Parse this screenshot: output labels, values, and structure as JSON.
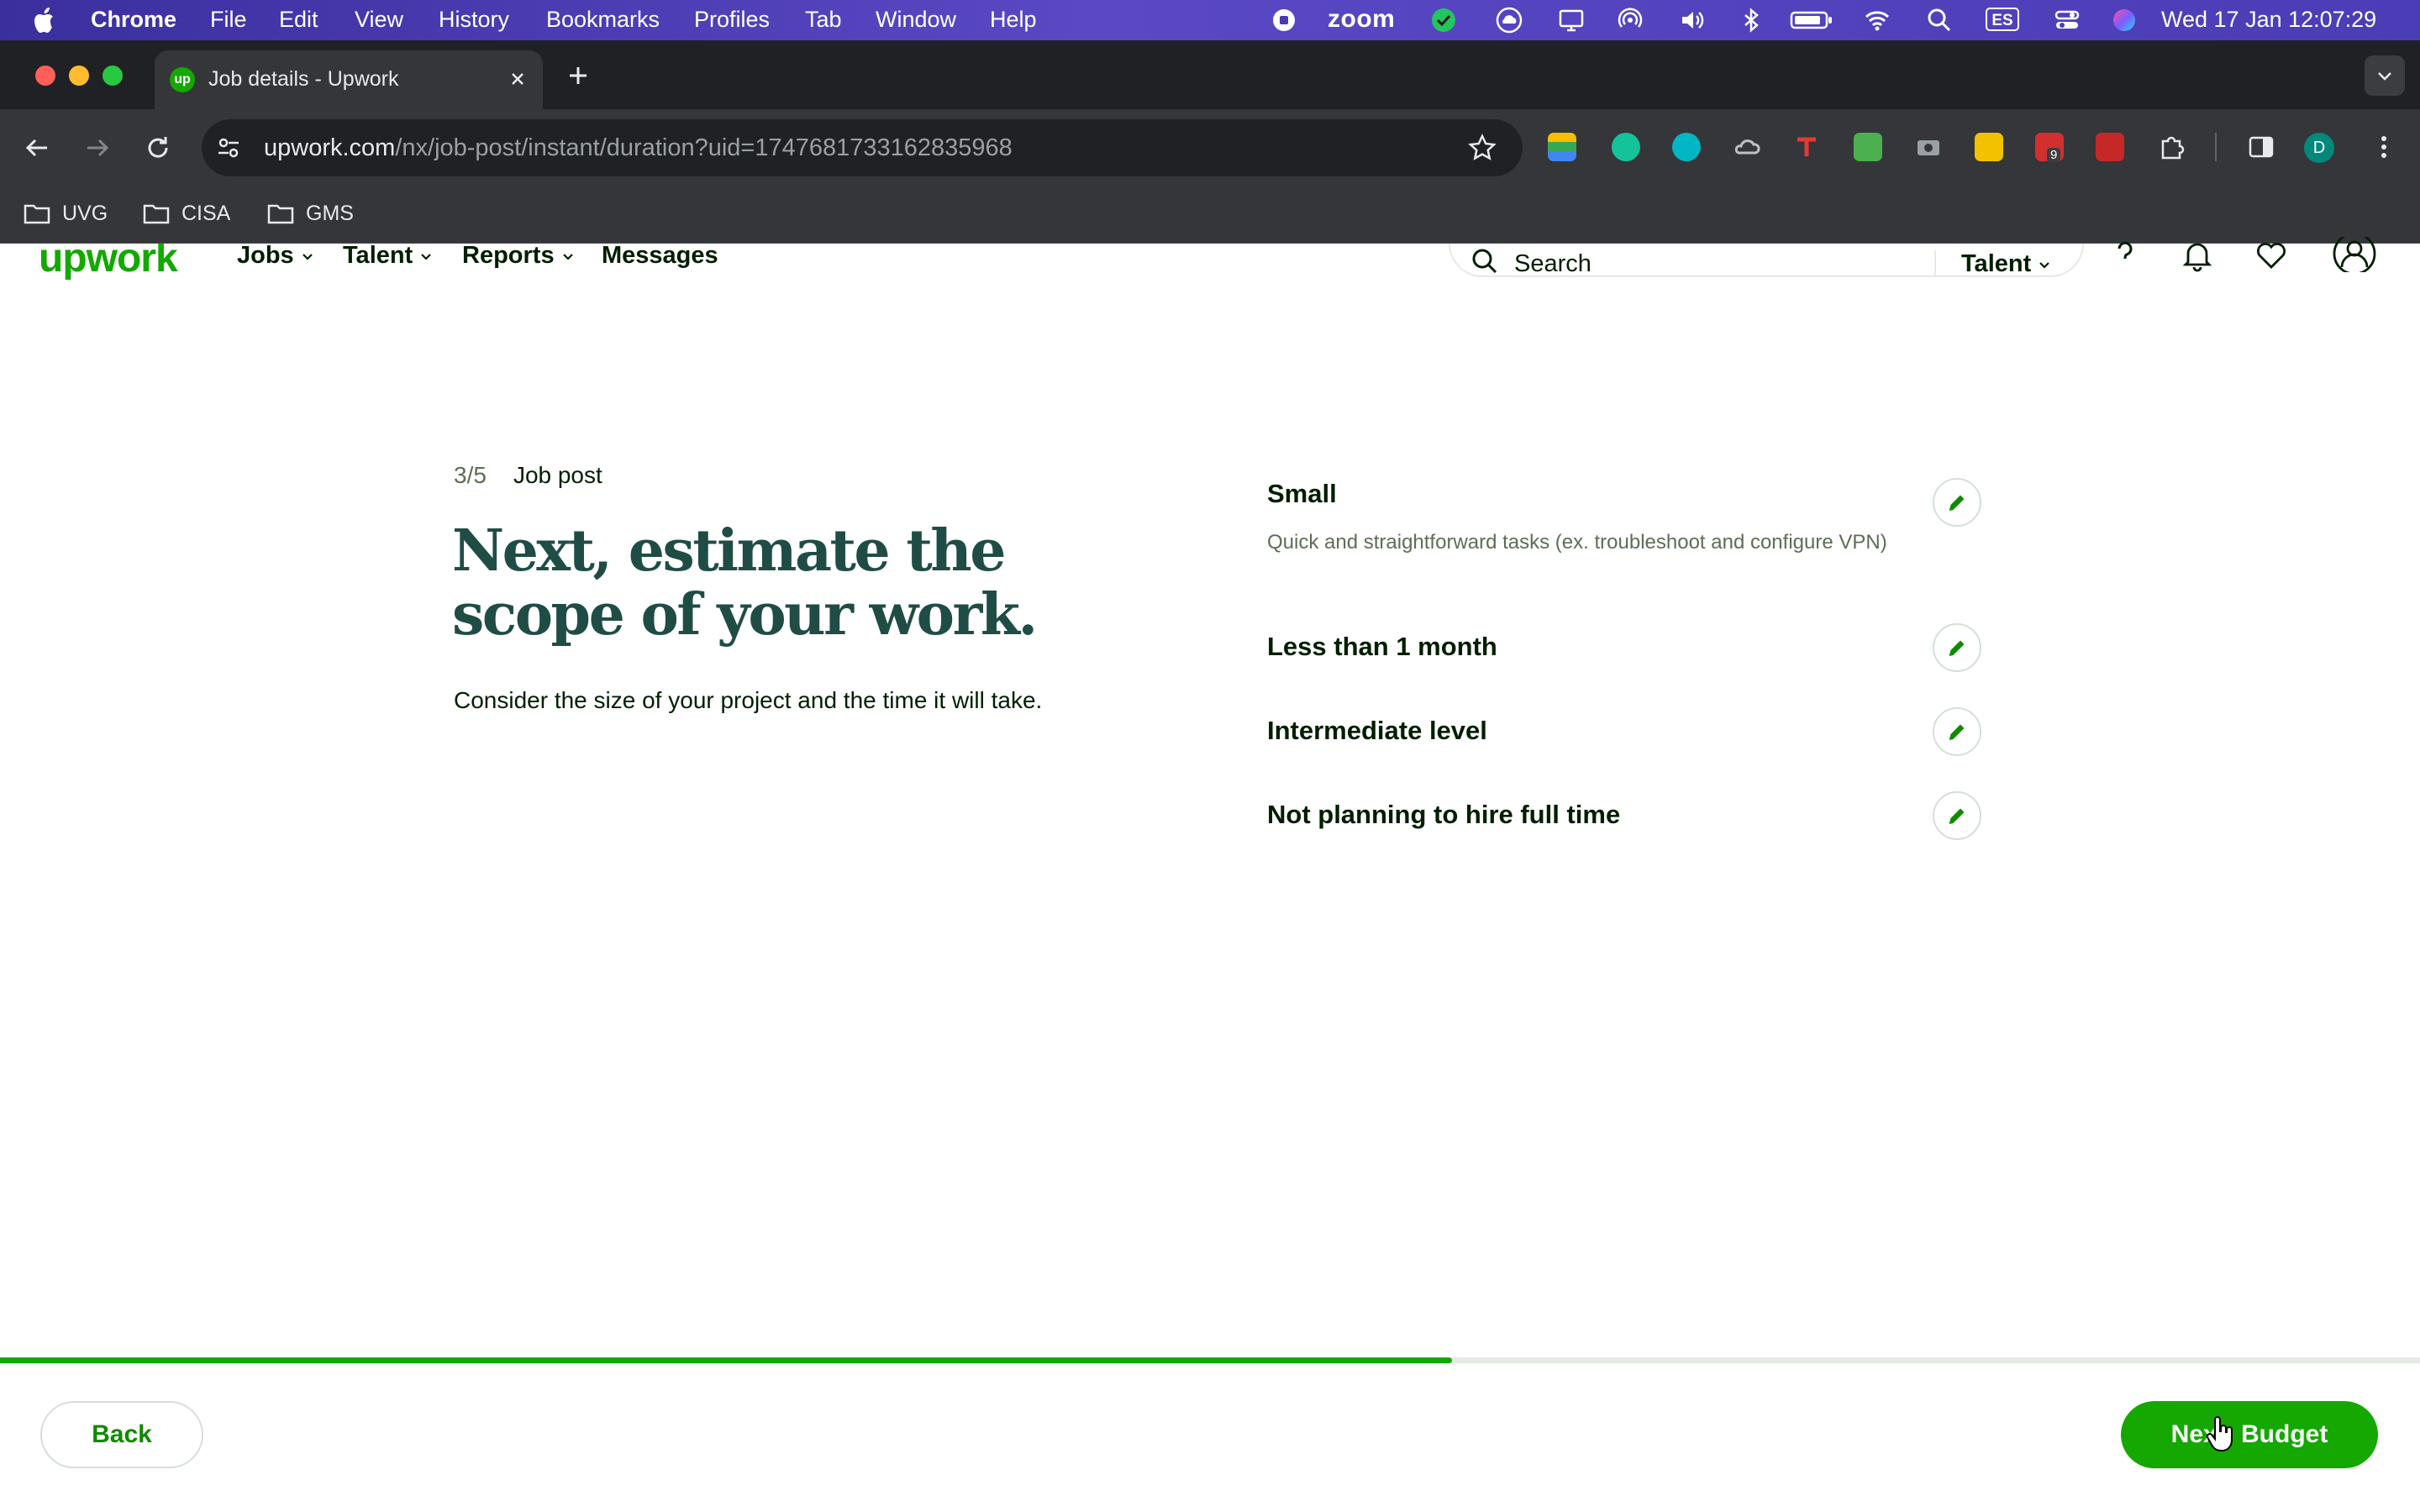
{
  "menubar": {
    "app_name": "Chrome",
    "items": [
      "File",
      "Edit",
      "View",
      "History",
      "Bookmarks",
      "Profiles",
      "Tab",
      "Window",
      "Help"
    ],
    "zoom_label": "zoom",
    "input_source": "ES",
    "clock": "Wed 17 Jan  12:07:29"
  },
  "browser": {
    "tab_title": "Job details - Upwork",
    "url_host": "upwork.com",
    "url_path": "/nx/job-post/instant/duration?uid=1747681733162835968",
    "extension_badge": "9",
    "profile_initial": "D",
    "bookmarks": [
      "UVG",
      "CISA",
      "GMS"
    ]
  },
  "upwork_header": {
    "logo": "upwork",
    "nav": [
      "Jobs",
      "Talent",
      "Reports",
      "Messages"
    ],
    "search_placeholder": "Search",
    "search_scope": "Talent"
  },
  "page": {
    "step": "3/5",
    "step_label": "Job post",
    "headline": "Next, estimate the scope of your work.",
    "subtext": "Consider the size of your project and the time it will take.",
    "selections": [
      {
        "title": "Small",
        "description": "Quick and straightforward tasks (ex. troubleshoot and configure VPN)"
      },
      {
        "title": "Less than 1 month"
      },
      {
        "title": "Intermediate level"
      },
      {
        "title": "Not planning to hire full time"
      }
    ]
  },
  "progress": {
    "fraction": 0.6
  },
  "footer": {
    "back_label": "Back",
    "next_label": "Next: Budget"
  },
  "colors": {
    "brand_green": "#14a800",
    "headline_green": "#1f4d46",
    "text_dark": "#001e00",
    "text_muted": "#5e6d55"
  },
  "icons": {
    "edit": "pencil-icon",
    "search": "search-icon",
    "help": "help-icon",
    "notifications": "bell-icon",
    "saved": "heart-icon",
    "account": "user-icon"
  }
}
